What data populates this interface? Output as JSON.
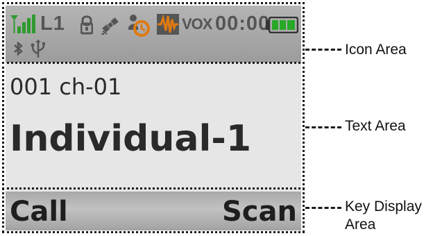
{
  "status_bar": {
    "channel_label": "L1",
    "vox_label": "VOX",
    "timer": "00:00",
    "icons": [
      "signal-strength-icon",
      "channel-l1",
      "lock-icon",
      "satellite-icon",
      "scrambler-icon",
      "audio-icon",
      "vox",
      "timer",
      "battery-icon",
      "bluetooth-icon",
      "usb-icon"
    ]
  },
  "text_area": {
    "channel_line": "001 ch-01",
    "name_line": "Individual-1"
  },
  "key_display": {
    "left_key": "Call",
    "right_key": "Scan"
  },
  "callouts": {
    "icon_area": "Icon Area",
    "text_area": "Text Area",
    "key_display_line1": "Key Display",
    "key_display_line2": "Area"
  },
  "colors": {
    "signal_green": "#2f9a2f",
    "battery_green": "#27a827",
    "icon_orange": "#e07a10",
    "icon_gray": "#555555"
  }
}
